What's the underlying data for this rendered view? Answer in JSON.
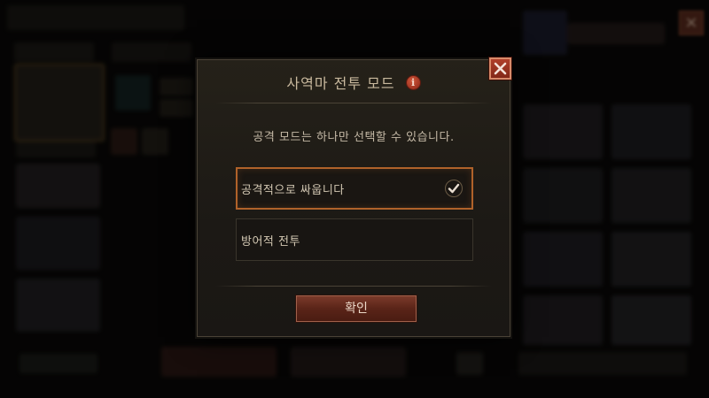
{
  "dialog": {
    "title": "사역마 전투 모드",
    "info_icon": "i",
    "description": "공격 모드는 하나만 선택할 수 있습니다.",
    "options": [
      {
        "label": "공격적으로 싸웁니다",
        "selected": true
      },
      {
        "label": "방어적 전투",
        "selected": false
      }
    ],
    "confirm_label": "확인",
    "close_icon": "close-icon"
  },
  "colors": {
    "accent_border": "#b0622a",
    "close_button": "#b0402a",
    "confirm_button": "#5a2418",
    "text": "#c9b99e"
  }
}
